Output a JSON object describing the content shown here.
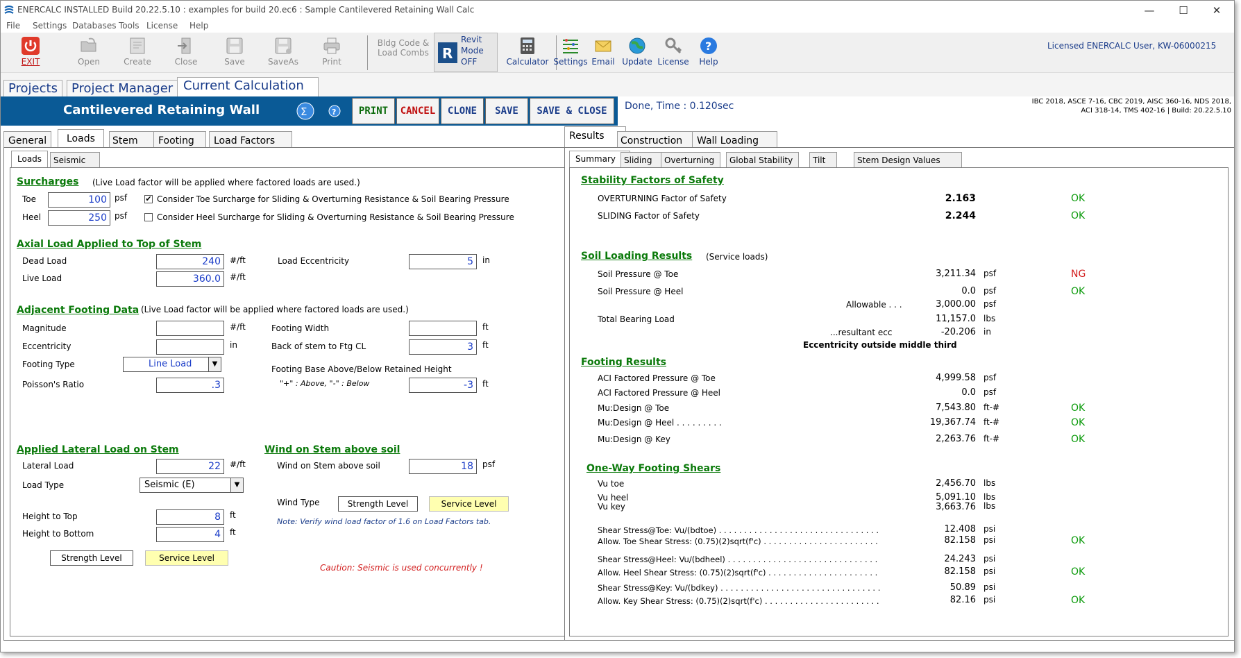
{
  "app": {
    "title": "ENERCALC INSTALLED Build 20.22.5.10 :  examples for build 20.ec6 : Sample Cantilevered Retaining Wall Calc",
    "window_controls": [
      "—",
      "☐",
      "✕"
    ]
  },
  "menu": [
    "File",
    "Settings",
    "Databases",
    "Tools",
    "License",
    "Help"
  ],
  "toolbar": {
    "exit": "EXIT",
    "open": "Open",
    "create": "Create",
    "close": "Close",
    "save": "Save",
    "saveas": "SaveAs",
    "print": "Print",
    "bldg_code_1": "Bldg Code &",
    "bldg_code_2": "Load Combs",
    "revit_1": "Revit",
    "revit_2": "Mode",
    "revit_3": "OFF",
    "calculator": "Calculator",
    "settings": "Settings",
    "email": "Email",
    "update": "Update",
    "license": "License",
    "help": "Help",
    "licensed": "Licensed ENERCALC User, KW-06000215"
  },
  "project_tabs": [
    "Projects",
    "Project Manager",
    "Current Calculation"
  ],
  "calc": {
    "title": "Cantilevered Retaining Wall",
    "print": "PRINT",
    "cancel": "CANCEL",
    "clone": "CLONE",
    "save": "SAVE",
    "save_close": "SAVE & CLOSE",
    "done_time": "Done, Time :  0.120sec",
    "codes_1": "IBC 2018, ASCE 7-16, CBC 2019, AISC 360-16, NDS 2018,",
    "codes_2": "ACI 318-14, TMS 402-16 | Build: 20.22.5.10"
  },
  "left_tabs": [
    "General",
    "Loads",
    "Stem",
    "Footing",
    "Load Factors"
  ],
  "left_subtabs": [
    "Loads",
    "Seismic"
  ],
  "loads": {
    "surcharges_title": "Surcharges",
    "surcharges_note": "(Live Load factor will be applied where factored loads are used.)",
    "toe_label": "Toe",
    "toe_value": "100",
    "heel_label": "Heel",
    "heel_value": "250",
    "psf": "psf",
    "toe_check_mark": "✔",
    "toe_check_label": "Consider Toe Surcharge for Sliding & Overturning Resistance & Soil Bearing Pressure",
    "heel_check_label": "Consider Heel Surcharge for Sliding & Overturning Resistance & Soil Bearing Pressure",
    "axial_title": "Axial Load Applied to Top of Stem",
    "dead_label": "Dead Load",
    "dead_value": "240",
    "live_label": "Live Load",
    "live_value": "360.0",
    "per_ft": "#/ft",
    "ecc_label": "Load Eccentricity",
    "ecc_value": "5",
    "in": "in",
    "adj_title": "Adjacent Footing Data",
    "adj_note": "(Live Load factor will be applied where factored loads are used.)",
    "magnitude_label": "Magnitude",
    "magnitude_value": "",
    "eccentricity_label": "Eccentricity",
    "eccentricity_value": "",
    "footing_type_label": "Footing Type",
    "footing_type_value": "Line Load",
    "poisson_label": "Poisson's Ratio",
    "poisson_value": ".3",
    "footing_width_label": "Footing Width",
    "footing_width_value": "",
    "ft": "ft",
    "back_stem_label": "Back of stem to Ftg CL",
    "back_stem_value": "3",
    "base_label": "Footing Base Above/Below Retained Height",
    "base_note": "\"+\" : Above,   \"-\" : Below",
    "base_value": "-3",
    "lateral_title": "Applied Lateral Load on Stem",
    "lateral_label": "Lateral Load",
    "lateral_value": "22",
    "load_type_label": "Load Type",
    "load_type_value": "Seismic (E)",
    "height_top_label": "Height to Top",
    "height_top_value": "8",
    "height_bottom_label": "Height to Bottom",
    "height_bottom_value": "4",
    "strength_level": "Strength Level",
    "service_level": "Service Level",
    "wind_title": "Wind on Stem above soil",
    "wind_label": "Wind on Stem above soil",
    "wind_value": "18",
    "wind_type_label": "Wind Type",
    "wind_note": "Note: Verify wind load factor of 1.6 on Load Factors tab.",
    "caution": "Caution: Seismic is used concurrently !"
  },
  "right_tabs": [
    "Results",
    "Construction",
    "Wall Loading"
  ],
  "right_subtabs": [
    "Summary",
    "Sliding",
    "Overturning",
    "Global Stability",
    "Tilt",
    "Stem Design Values"
  ],
  "results": {
    "stability_title": "Stability Factors of Safety",
    "overturning_label": "OVERTURNING Factor of Safety",
    "overturning_value": "2.163",
    "sliding_label": "SLIDING Factor of Safety",
    "sliding_value": "2.244",
    "ok": "OK",
    "ng": "NG",
    "soil_title": "Soil Loading Results",
    "soil_note": "(Service loads)",
    "soil_toe_label": "Soil Pressure @ Toe",
    "soil_toe_value": "3,211.34",
    "soil_heel_label": "Soil Pressure @ Heel",
    "soil_heel_value": "0.0",
    "allowable_label": "Allowable . . .",
    "allowable_value": "3,000.00",
    "psf": "psf",
    "total_bearing_label": "Total Bearing Load",
    "total_bearing_value": "11,157.0",
    "lbs": "lbs",
    "resultant_label": "...resultant ecc",
    "resultant_value": "-20.206",
    "in": "in",
    "ecc_outside": "Eccentricity outside middle third",
    "footing_title": "Footing Results",
    "aci_toe_label": "ACI Factored Pressure @ Toe",
    "aci_toe_value": "4,999.58",
    "aci_heel_label": "ACI Factored Pressure @ Heel",
    "aci_heel_value": "0.0",
    "mu_toe_label": "Mu:Design @ Toe",
    "mu_toe_value": "7,543.80",
    "ftlb": "ft-#",
    "mu_heel_label": "Mu:Design @ Heel . . . . . . . . .",
    "mu_heel_value": "19,367.74",
    "mu_key_label": "Mu:Design @ Key",
    "mu_key_value": "2,263.76",
    "shear_title": "One-Way Footing Shears",
    "vu_toe_label": "Vu toe",
    "vu_toe_value": "2,456.70",
    "vu_heel_label": "Vu heel",
    "vu_heel_value": "5,091.10",
    "vu_key_label": "Vu key",
    "vu_key_value": "3,663.76",
    "ss_toe_label": "Shear Stress@Toe: Vu/(bdtoe) . . . . . . . . . . . . . . . . . . . . . . . . . . . . . . . .",
    "ss_toe_value": "12.408",
    "psi": "psi",
    "allow_toe_label": "Allow. Toe Shear Stress: (0.75)(2)sqrt(f'c) . . . . . . . . . . . . . . . . . . . . . . .",
    "allow_toe_value": "82.158",
    "ss_heel_label": "Shear Stress@Heel: Vu/(bdheel) . . . . . . . . . . . . . . . . . . . . . . . . . . . . . .",
    "ss_heel_value": "24.243",
    "allow_heel_label": "Allow. Heel Shear Stress: (0.75)(2)sqrt(f'c) . . . . . . . . . . . . . . . . . . . . . .",
    "allow_heel_value": "82.158",
    "ss_key_label": "Shear Stress@Key: Vu/(bdkey) . . . . . . . . . . . . . . . . . . . . . . . . . . . . . . . .",
    "ss_key_value": "50.89",
    "allow_key_label": "Allow. Key Shear Stress: (0.75)(2)sqrt(f'c) . . . . . . . . . . . . . . . . . . . . . . .",
    "allow_key_value": "82.16"
  }
}
